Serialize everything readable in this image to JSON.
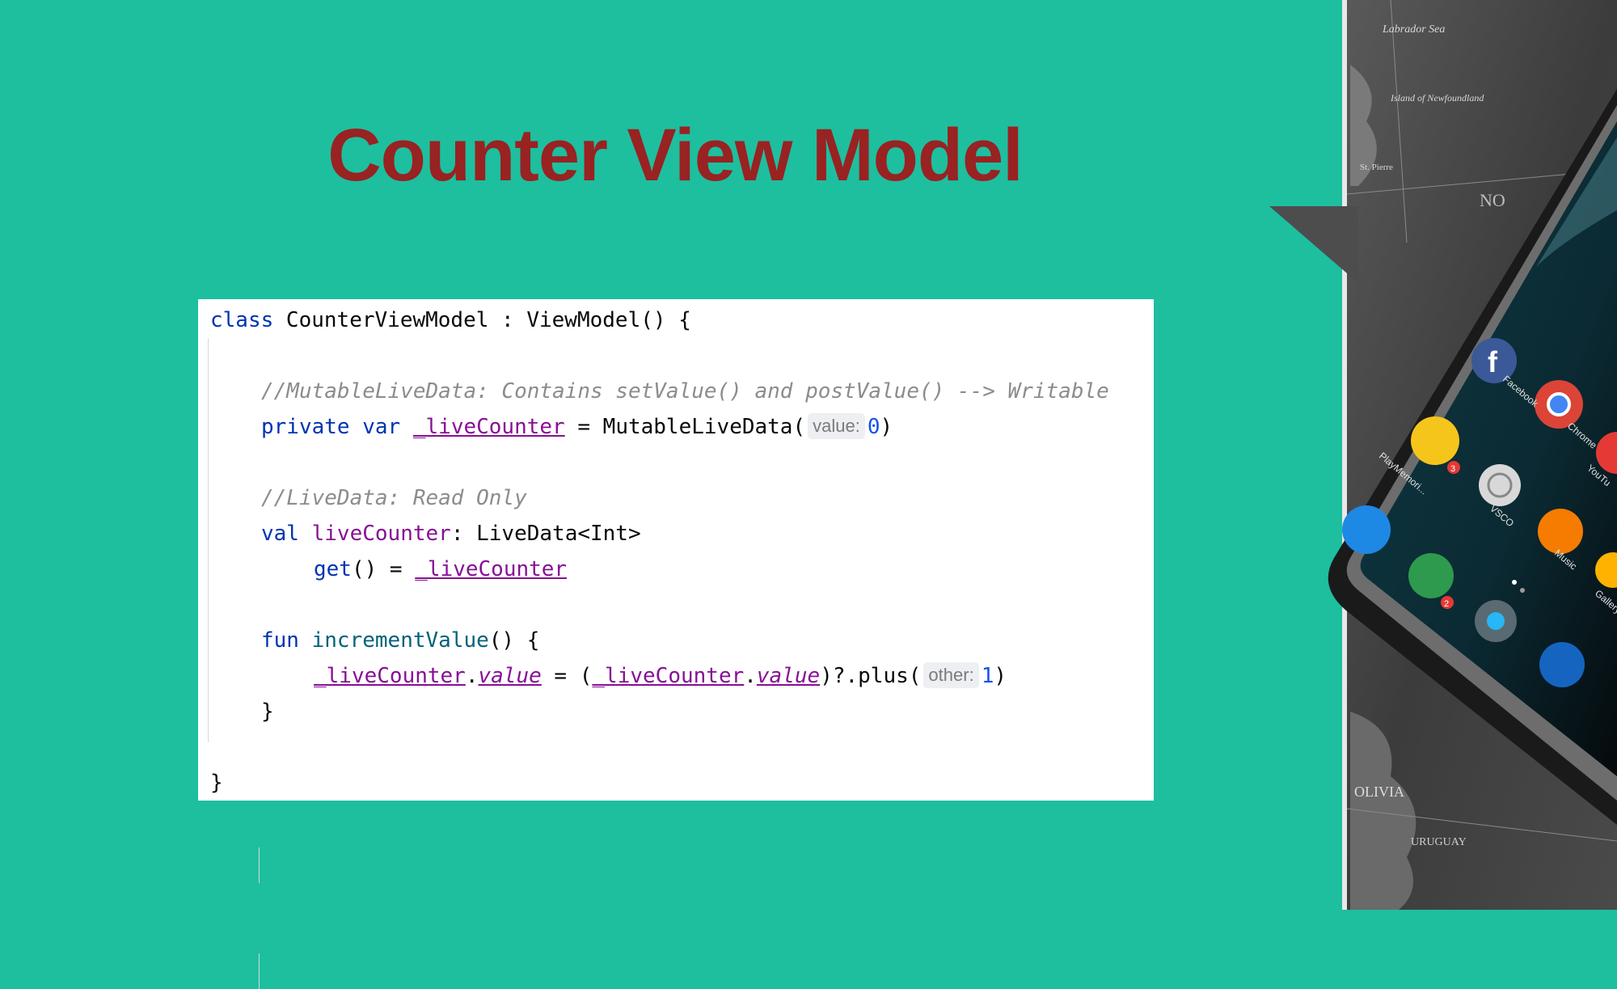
{
  "slide": {
    "title": "Counter View Model"
  },
  "code": {
    "line1": {
      "kw": "class",
      "rest": " CounterViewModel : ViewModel() {"
    },
    "line3": {
      "comment": "//MutableLiveData: Contains setValue() and postValue() --> Writable"
    },
    "line4": {
      "kw1": "private",
      "kw2": "var",
      "prop": "_liveCounter",
      "mid": " = MutableLiveData(",
      "hint": "value:",
      "num": "0",
      "end": ")"
    },
    "line6": {
      "comment": "//LiveData: Read Only"
    },
    "line7": {
      "kw": "val",
      "prop": "liveCounter",
      "rest": ": LiveData<Int>"
    },
    "line8": {
      "kw": "get",
      "mid": "() = ",
      "prop": "_liveCounter"
    },
    "line10": {
      "kw": "fun",
      "fn": "incrementValue",
      "rest": "() {"
    },
    "line11": {
      "prop1": "_liveCounter",
      "dot1": ".",
      "val1": "value",
      "eq": " = (",
      "prop2": "_liveCounter",
      "dot2": ".",
      "val2": "value",
      "call": ")?.plus(",
      "hint": "other:",
      "num": "1",
      "end": ")"
    },
    "line12": {
      "text": "}"
    },
    "line14": {
      "text": "}"
    }
  },
  "picture": {
    "map_labels": [
      "Labrador Sea",
      "Island of Newfoundland",
      "St. Pierre",
      "NO",
      "OLIVIA",
      "URUGUAY"
    ],
    "apps": [
      "Facebook",
      "Chrome",
      "PlayMemori...",
      "VSCO",
      "YouTu",
      "Music",
      "Gallery"
    ],
    "badges": [
      "3",
      "2"
    ]
  },
  "colors": {
    "background": "#1dbf9f",
    "title": "#992222"
  }
}
